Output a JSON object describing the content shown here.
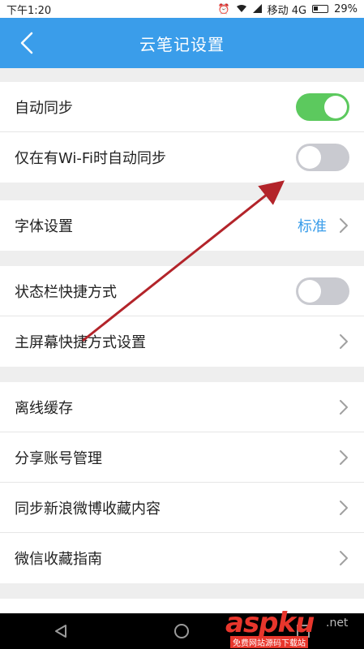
{
  "status_bar": {
    "time": "下午1:20",
    "carrier": "移动 4G",
    "battery": "29%",
    "icons": [
      "alarm-icon",
      "wifi-icon",
      "signal-icon",
      "battery-icon"
    ]
  },
  "header": {
    "title": "云笔记设置",
    "back_icon": "chevron-left-icon",
    "background": "#3a9dea"
  },
  "groups": [
    {
      "rows": [
        {
          "label": "自动同步",
          "control": "toggle",
          "on": true
        },
        {
          "label": "仅在有Wi-Fi时自动同步",
          "control": "toggle",
          "on": false
        }
      ]
    },
    {
      "rows": [
        {
          "label": "字体设置",
          "control": "value-chevron",
          "value": "标准"
        }
      ]
    },
    {
      "rows": [
        {
          "label": "状态栏快捷方式",
          "control": "toggle",
          "on": false
        },
        {
          "label": "主屏幕快捷方式设置",
          "control": "chevron"
        }
      ]
    },
    {
      "rows": [
        {
          "label": "离线缓存",
          "control": "chevron"
        },
        {
          "label": "分享账号管理",
          "control": "chevron"
        },
        {
          "label": "同步新浪微博收藏内容",
          "control": "chevron"
        },
        {
          "label": "微信收藏指南",
          "control": "chevron"
        }
      ]
    }
  ],
  "navigation_bar": {
    "buttons": [
      "back-triangle-icon",
      "home-circle-icon",
      "recents-icon"
    ]
  },
  "annotation": {
    "type": "arrow",
    "color": "#b3242a",
    "points_to": "仅在有Wi-Fi时自动同步"
  },
  "watermark": {
    "brand": "aspku",
    "suffix": ".net",
    "subtext": "免费网站源码下载站"
  },
  "colors": {
    "accent": "#3a9dea",
    "toggle_on": "#5cc95e",
    "toggle_off": "#c9cad0",
    "chevron": "#a0a0a0"
  }
}
